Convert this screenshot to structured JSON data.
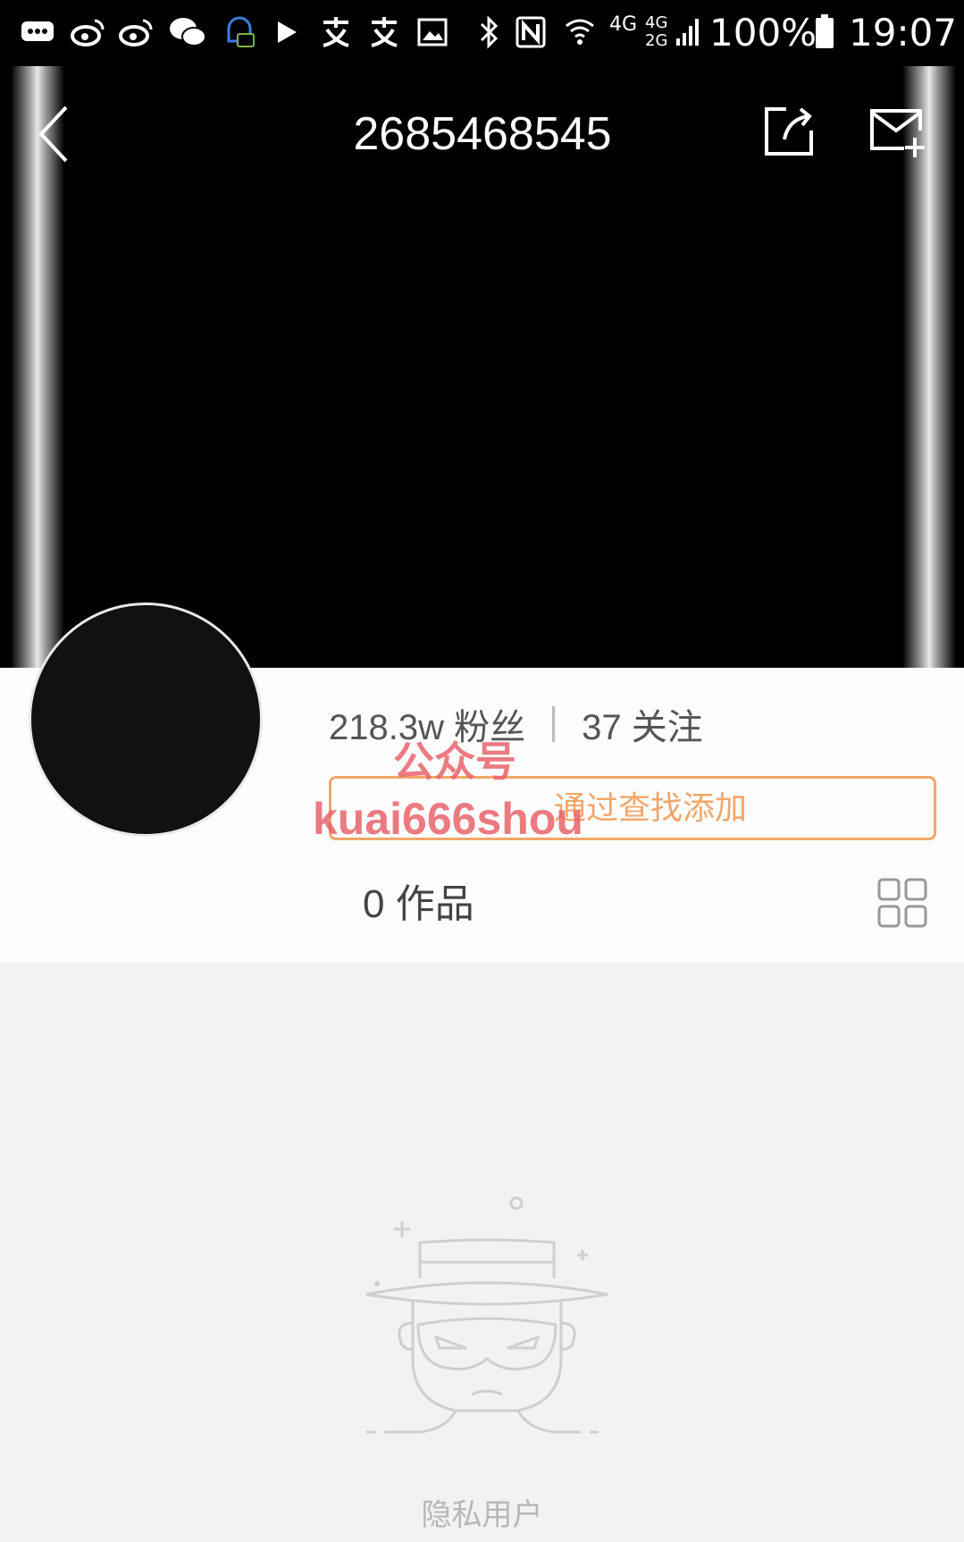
{
  "status_bar": {
    "network_4g": "4G",
    "network_4g_2g_top": "4G",
    "network_4g_2g_bottom": "2G",
    "battery": "100%",
    "time": "19:07"
  },
  "header": {
    "title": "2685468545"
  },
  "profile": {
    "followers": "218.3w 粉丝",
    "following": "37 关注",
    "search_hint": "通过查找添加",
    "works": "0 作品"
  },
  "watermark": {
    "line1": "公众号",
    "line2": "kuai666shou"
  },
  "empty_state": {
    "label": "隐私用户"
  },
  "colors": {
    "accent": "#f2a66a",
    "watermark": "#e8646c",
    "background": "#f2f2f2"
  }
}
